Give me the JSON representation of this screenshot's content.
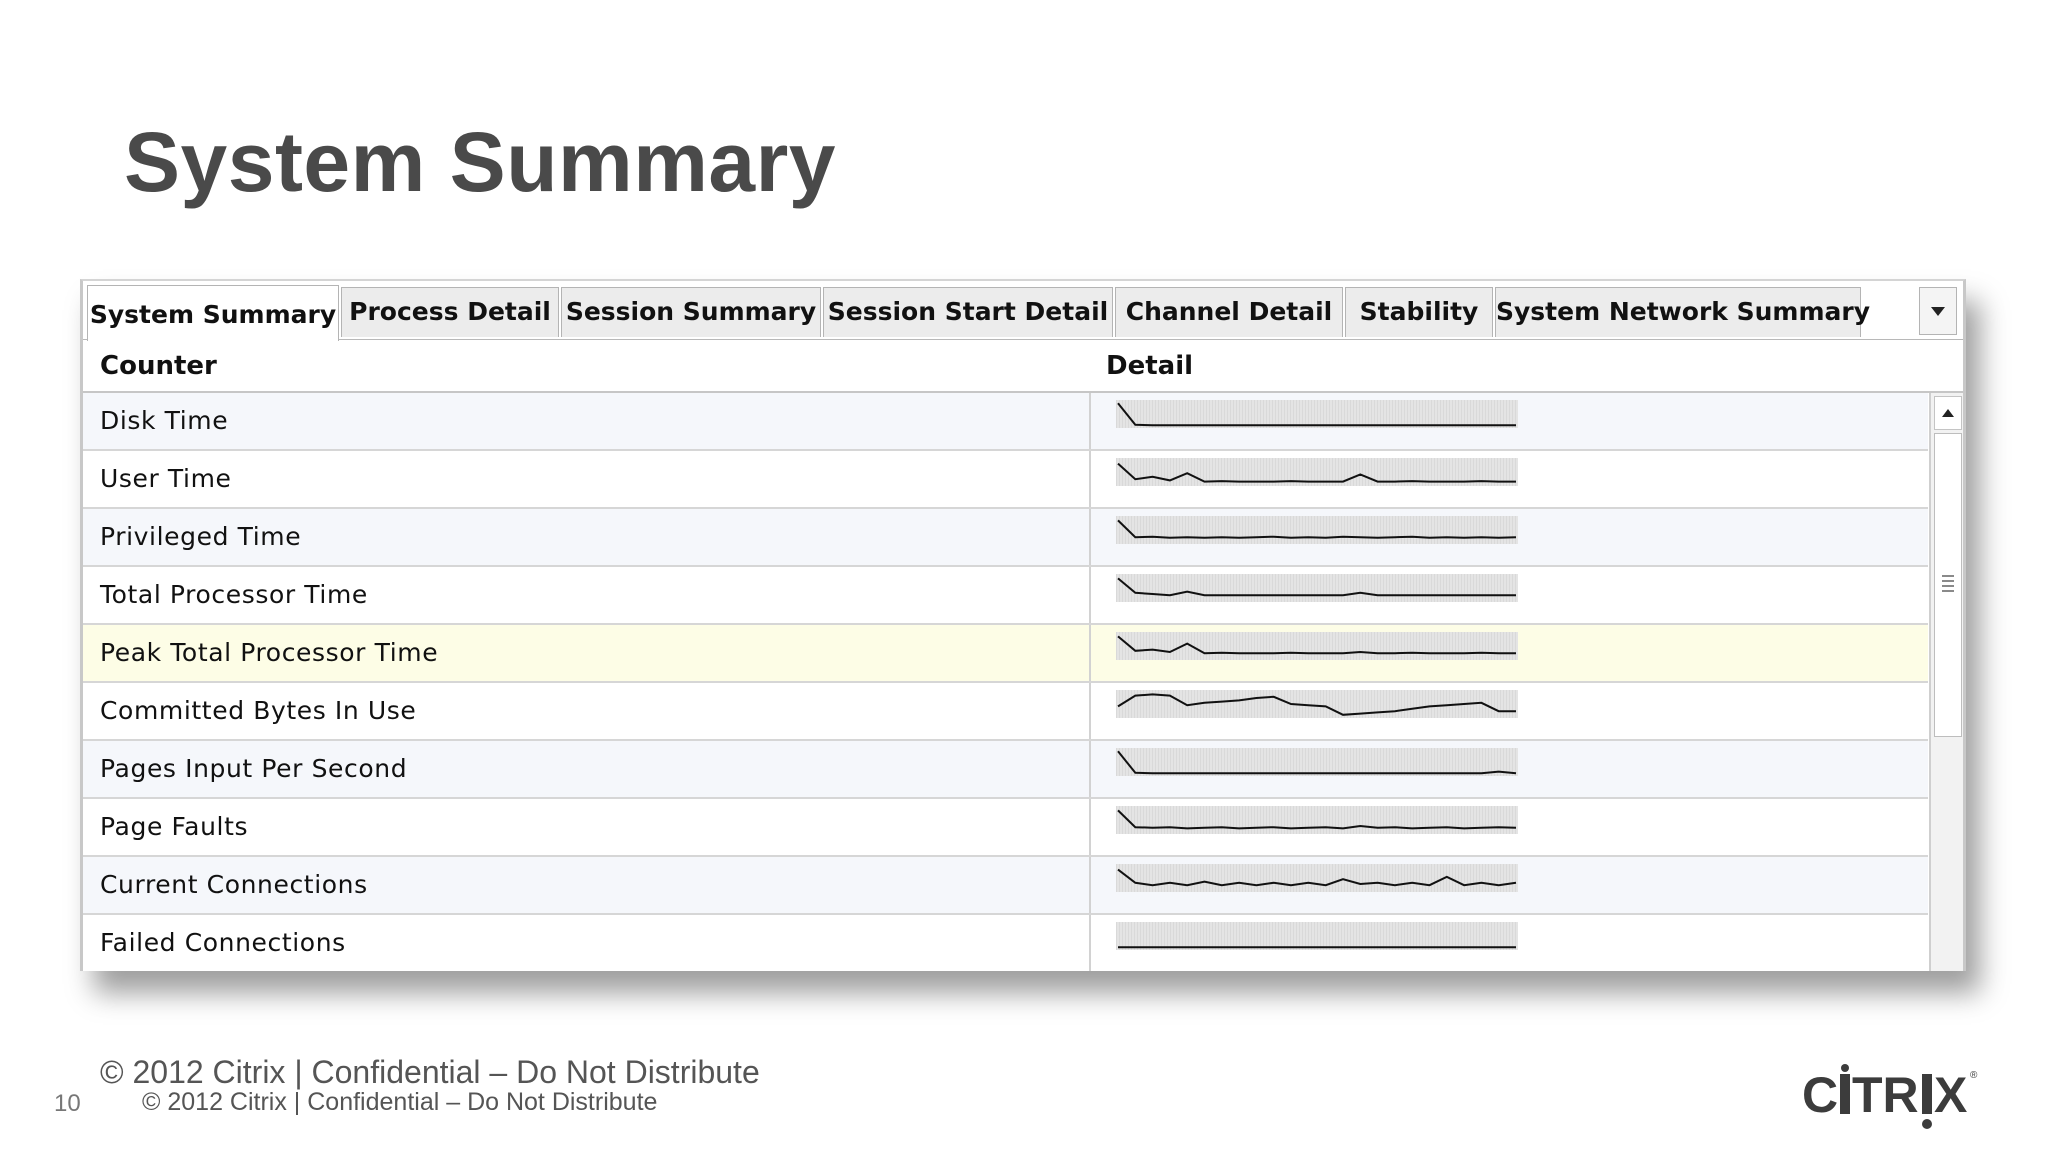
{
  "slide": {
    "title": "System Summary",
    "footer_large": "© 2012 Citrix | Confidential – Do Not Distribute",
    "footer_small": "© 2012 Citrix | Confidential – Do Not Distribute",
    "page_number": "10",
    "logo_text": "CITRIX"
  },
  "tabs": [
    {
      "label": "System Summary",
      "active": true
    },
    {
      "label": "Process Detail",
      "active": false
    },
    {
      "label": "Session Summary",
      "active": false
    },
    {
      "label": "Session Start Detail",
      "active": false
    },
    {
      "label": "Channel Detail",
      "active": false
    },
    {
      "label": "Stability",
      "active": false
    },
    {
      "label": "System Network Summary",
      "active": false
    }
  ],
  "tab_overflow_icon": "chevron-down-icon",
  "table": {
    "columns": [
      "Counter",
      "Detail"
    ],
    "rows": [
      {
        "counter": "Disk Time",
        "trend": [
          0.95,
          0.05,
          0.03,
          0.03,
          0.03,
          0.03,
          0.03,
          0.03,
          0.03,
          0.03,
          0.03,
          0.03,
          0.03,
          0.03,
          0.03,
          0.03,
          0.03,
          0.03,
          0.03,
          0.03,
          0.03,
          0.03,
          0.03,
          0.03
        ]
      },
      {
        "counter": "User Time",
        "trend": [
          0.85,
          0.2,
          0.3,
          0.15,
          0.45,
          0.1,
          0.12,
          0.1,
          0.1,
          0.1,
          0.12,
          0.1,
          0.1,
          0.1,
          0.4,
          0.1,
          0.1,
          0.12,
          0.1,
          0.1,
          0.1,
          0.12,
          0.1,
          0.1
        ]
      },
      {
        "counter": "Privileged Time",
        "trend": [
          0.9,
          0.2,
          0.22,
          0.18,
          0.2,
          0.18,
          0.2,
          0.18,
          0.2,
          0.22,
          0.18,
          0.2,
          0.18,
          0.22,
          0.2,
          0.18,
          0.2,
          0.22,
          0.18,
          0.2,
          0.18,
          0.2,
          0.18,
          0.2
        ]
      },
      {
        "counter": "Total Processor Time",
        "trend": [
          0.9,
          0.3,
          0.25,
          0.2,
          0.35,
          0.2,
          0.2,
          0.2,
          0.2,
          0.2,
          0.2,
          0.2,
          0.2,
          0.2,
          0.3,
          0.2,
          0.2,
          0.2,
          0.2,
          0.2,
          0.2,
          0.2,
          0.2,
          0.2
        ]
      },
      {
        "counter": "Peak Total Processor Time",
        "trend": [
          0.9,
          0.3,
          0.35,
          0.25,
          0.6,
          0.2,
          0.22,
          0.2,
          0.2,
          0.2,
          0.22,
          0.2,
          0.2,
          0.2,
          0.25,
          0.2,
          0.2,
          0.22,
          0.2,
          0.2,
          0.2,
          0.22,
          0.2,
          0.2
        ]
      },
      {
        "counter": "Committed Bytes In Use",
        "trend": [
          0.4,
          0.85,
          0.9,
          0.85,
          0.45,
          0.55,
          0.6,
          0.65,
          0.75,
          0.8,
          0.5,
          0.45,
          0.4,
          0.05,
          0.1,
          0.15,
          0.2,
          0.3,
          0.4,
          0.45,
          0.5,
          0.55,
          0.2,
          0.2
        ]
      },
      {
        "counter": "Pages Input Per Second",
        "trend": [
          0.95,
          0.05,
          0.03,
          0.03,
          0.03,
          0.03,
          0.03,
          0.03,
          0.03,
          0.03,
          0.03,
          0.03,
          0.03,
          0.03,
          0.03,
          0.03,
          0.03,
          0.03,
          0.03,
          0.03,
          0.03,
          0.03,
          0.1,
          0.03
        ]
      },
      {
        "counter": "Page Faults",
        "trend": [
          0.9,
          0.2,
          0.18,
          0.2,
          0.15,
          0.18,
          0.2,
          0.15,
          0.18,
          0.2,
          0.15,
          0.18,
          0.2,
          0.15,
          0.25,
          0.18,
          0.2,
          0.15,
          0.18,
          0.2,
          0.15,
          0.18,
          0.2,
          0.18
        ]
      },
      {
        "counter": "Current Connections",
        "trend": [
          0.85,
          0.3,
          0.2,
          0.3,
          0.2,
          0.35,
          0.2,
          0.3,
          0.2,
          0.3,
          0.2,
          0.3,
          0.2,
          0.45,
          0.25,
          0.3,
          0.2,
          0.3,
          0.2,
          0.55,
          0.2,
          0.3,
          0.2,
          0.3
        ]
      },
      {
        "counter": "Failed Connections",
        "trend": [
          0.03,
          0.03,
          0.03,
          0.03,
          0.03,
          0.03,
          0.03,
          0.03,
          0.03,
          0.03,
          0.03,
          0.03,
          0.03,
          0.03,
          0.03,
          0.03,
          0.03,
          0.03,
          0.03,
          0.03,
          0.03,
          0.03,
          0.03,
          0.03
        ]
      }
    ],
    "highlighted_row": 4
  }
}
